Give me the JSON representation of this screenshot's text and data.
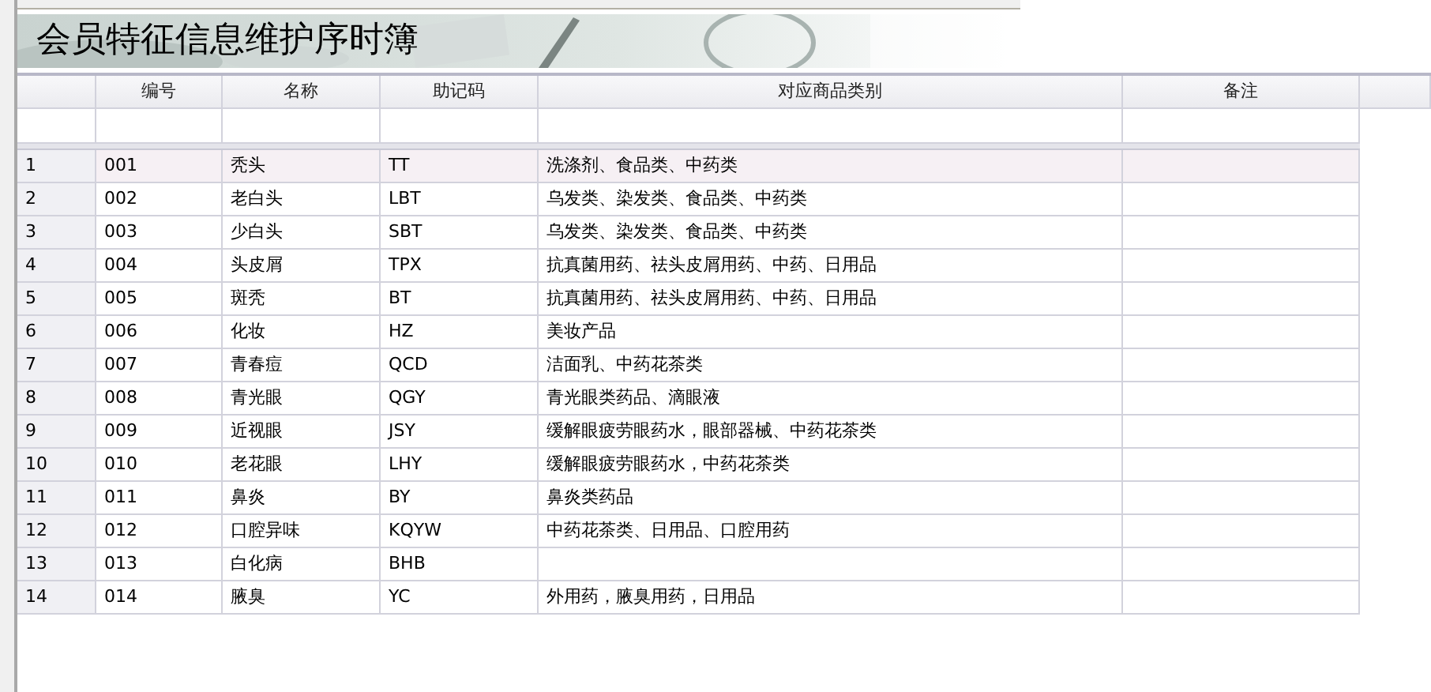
{
  "window": {
    "title": "会员特征信息维护序时簿"
  },
  "table": {
    "columns": [
      "",
      "编号",
      "名称",
      "助记码",
      "对应商品类别",
      "备注"
    ],
    "rows": [
      {
        "cells": [
          "1",
          "001",
          "秃头",
          "TT",
          "洗涤剂、食品类、中药类",
          ""
        ],
        "selected": true
      },
      {
        "cells": [
          "2",
          "002",
          "老白头",
          "LBT",
          "乌发类、染发类、食品类、中药类",
          ""
        ],
        "selected": false
      },
      {
        "cells": [
          "3",
          "003",
          "少白头",
          "SBT",
          "乌发类、染发类、食品类、中药类",
          ""
        ],
        "selected": false
      },
      {
        "cells": [
          "4",
          "004",
          "头皮屑",
          "TPX",
          "抗真菌用药、祛头皮屑用药、中药、日用品",
          ""
        ],
        "selected": false
      },
      {
        "cells": [
          "5",
          "005",
          "斑秃",
          "BT",
          "抗真菌用药、祛头皮屑用药、中药、日用品",
          ""
        ],
        "selected": false
      },
      {
        "cells": [
          "6",
          "006",
          "化妆",
          "HZ",
          "美妆产品",
          ""
        ],
        "selected": false
      },
      {
        "cells": [
          "7",
          "007",
          "青春痘",
          "QCD",
          "洁面乳、中药花茶类",
          ""
        ],
        "selected": false
      },
      {
        "cells": [
          "8",
          "008",
          "青光眼",
          "QGY",
          "青光眼类药品、滴眼液",
          ""
        ],
        "selected": false
      },
      {
        "cells": [
          "9",
          "009",
          "近视眼",
          "JSY",
          "缓解眼疲劳眼药水，眼部器械、中药花茶类",
          ""
        ],
        "selected": false
      },
      {
        "cells": [
          "10",
          "010",
          "老花眼",
          "LHY",
          "缓解眼疲劳眼药水，中药花茶类",
          ""
        ],
        "selected": false
      },
      {
        "cells": [
          "11",
          "011",
          "鼻炎",
          "BY",
          "鼻炎类药品",
          ""
        ],
        "selected": false
      },
      {
        "cells": [
          "12",
          "012",
          "口腔异味",
          "KQYW",
          "中药花茶类、日用品、口腔用药",
          ""
        ],
        "selected": false
      },
      {
        "cells": [
          "13",
          "013",
          "白化病",
          "BHB",
          "",
          ""
        ],
        "selected": false
      },
      {
        "cells": [
          "14",
          "014",
          "腋臭",
          "YC",
          "外用药，腋臭用药，日用品",
          ""
        ],
        "selected": false
      }
    ]
  }
}
